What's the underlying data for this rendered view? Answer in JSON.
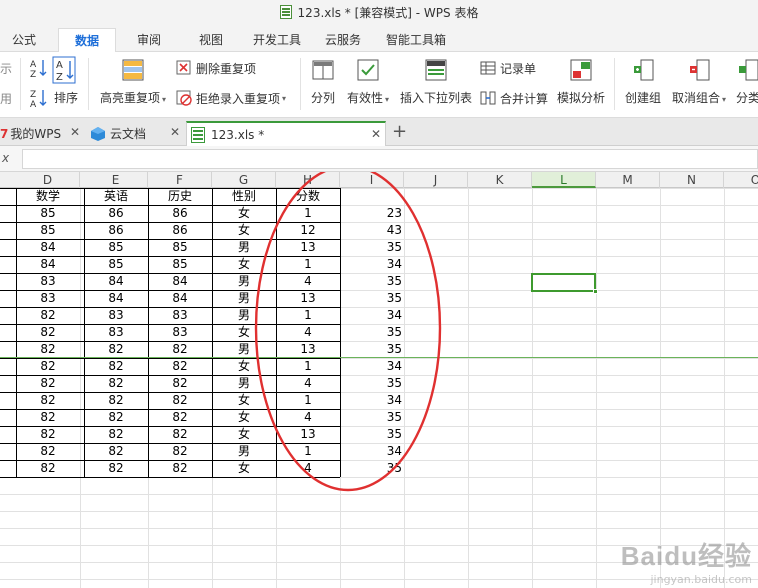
{
  "window": {
    "title": "123.xls * [兼容模式] - WPS 表格"
  },
  "menu": {
    "tabs": [
      {
        "label": "公式",
        "active": false
      },
      {
        "label": "数据",
        "active": true
      },
      {
        "label": "审阅",
        "active": false
      },
      {
        "label": "视图",
        "active": false
      },
      {
        "label": "开发工具",
        "active": false
      },
      {
        "label": "云服务",
        "active": false
      },
      {
        "label": "智能工具箱",
        "active": false
      }
    ]
  },
  "ribbon": {
    "cut_left_top": "示",
    "cut_left_bottom": "用",
    "sort_label": "排序",
    "highlight_dup": "高亮重复项",
    "remove_dup": "删除重复项",
    "reject_dup": "拒绝录入重复项",
    "split": "分列",
    "validity": "有效性",
    "dropdown_list": "插入下拉列表",
    "record": "记录单",
    "consolidate": "合并计算",
    "simulate": "模拟分析",
    "create_group": "创建组",
    "ungroup": "取消组合",
    "cut_right": "分类"
  },
  "doc_tabs": [
    {
      "label": "我的WPS",
      "icon": "wps-icon",
      "active": false
    },
    {
      "label": "云文档",
      "icon": "cloud-doc-icon",
      "active": false
    },
    {
      "label": "123.xls *",
      "icon": "xls-file-icon",
      "active": true
    }
  ],
  "formula_bar": {
    "left_stub": "x"
  },
  "sheet": {
    "columns": [
      "D",
      "E",
      "F",
      "G",
      "H",
      "I",
      "J",
      "K",
      "L",
      "M",
      "N",
      "O"
    ],
    "selected_column": "L",
    "header_row": [
      "数学",
      "英语",
      "历史",
      "性别",
      "分数"
    ],
    "rows": [
      [
        "85",
        "86",
        "86",
        "女",
        "1",
        "23"
      ],
      [
        "85",
        "86",
        "86",
        "女",
        "12",
        "43"
      ],
      [
        "84",
        "85",
        "85",
        "男",
        "13",
        "35"
      ],
      [
        "84",
        "85",
        "85",
        "女",
        "1",
        "34"
      ],
      [
        "83",
        "84",
        "84",
        "男",
        "4",
        "35"
      ],
      [
        "83",
        "84",
        "84",
        "男",
        "13",
        "35"
      ],
      [
        "82",
        "83",
        "83",
        "男",
        "1",
        "34"
      ],
      [
        "82",
        "83",
        "83",
        "女",
        "4",
        "35"
      ],
      [
        "82",
        "82",
        "82",
        "男",
        "13",
        "35"
      ],
      [
        "82",
        "82",
        "82",
        "女",
        "1",
        "34"
      ],
      [
        "82",
        "82",
        "82",
        "男",
        "4",
        "35"
      ],
      [
        "82",
        "82",
        "82",
        "女",
        "1",
        "34"
      ],
      [
        "82",
        "82",
        "82",
        "女",
        "4",
        "35"
      ],
      [
        "82",
        "82",
        "82",
        "女",
        "13",
        "35"
      ],
      [
        "82",
        "82",
        "82",
        "男",
        "1",
        "34"
      ],
      [
        "82",
        "82",
        "82",
        "女",
        "4",
        "35"
      ]
    ]
  },
  "colors": {
    "accent_green": "#3e9a2e",
    "annotation_red": "#e03030",
    "tab_blue": "#1e6fd9"
  },
  "watermark": {
    "brand": "Baidu经验",
    "url": "jingyan.baidu.com"
  }
}
